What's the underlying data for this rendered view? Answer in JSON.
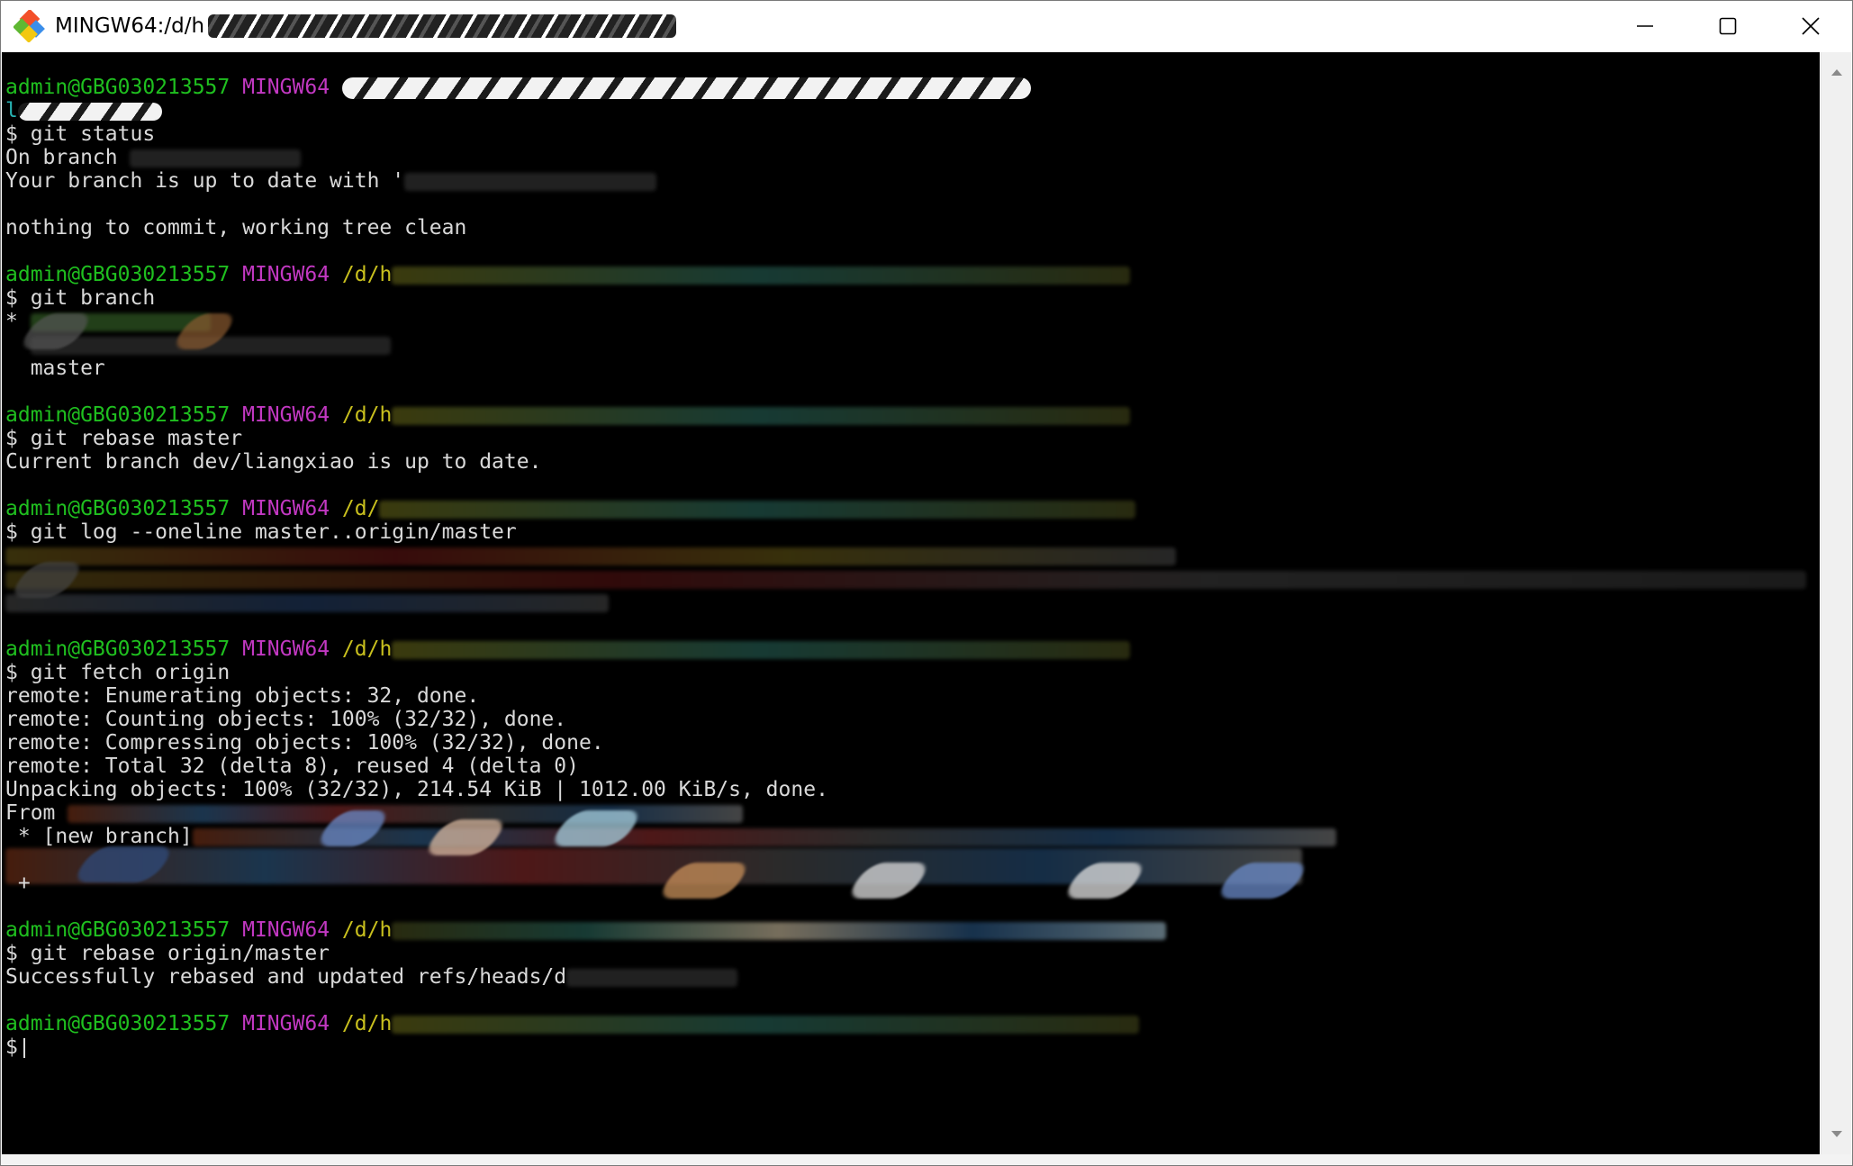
{
  "window": {
    "title": "MINGW64:/d/h",
    "title_suffix_redacted": true,
    "controls": [
      "minimize-icon",
      "maximize-icon",
      "close-icon"
    ]
  },
  "prompt": {
    "user_host": "admin@GBG030213557",
    "shell": "MINGW64",
    "path_prefix": "/d/",
    "path_short": "/d/h"
  },
  "lines": {
    "l3": "$ git status",
    "l4": "On branch",
    "l5": "Your branch is up to date with '",
    "l6": "nothing to commit, working tree clean",
    "l8": "$ git branch",
    "l9": "*",
    "l11": "  master",
    "l14": "$ git rebase master",
    "l15": "Current branch dev/liangxiao is up to date.",
    "l18": "$ git log --oneline master..origin/master",
    "l24": "$ git fetch origin",
    "l25": "remote: Enumerating objects: 32, done.",
    "l26": "remote: Counting objects: 100% (32/32), done.",
    "l27": "remote: Compressing objects: 100% (32/32), done.",
    "l28": "remote: Total 32 (delta 8), reused 4 (delta 0)",
    "l29": "Unpacking objects: 100% (32/32), 214.54 KiB | 1012.00 KiB/s, done.",
    "l30": "From",
    "l31": " * [new branch]",
    "l32": " +",
    "l35": "$ git rebase origin/master",
    "l36": "Successfully rebased and updated refs/heads/d",
    "l39": "$"
  },
  "colors": {
    "terminal_bg": "#000000",
    "prompt_user": "#1fbf1f",
    "prompt_shell": "#c238c2",
    "prompt_path": "#c9c01e",
    "text": "#d9d9d9"
  }
}
